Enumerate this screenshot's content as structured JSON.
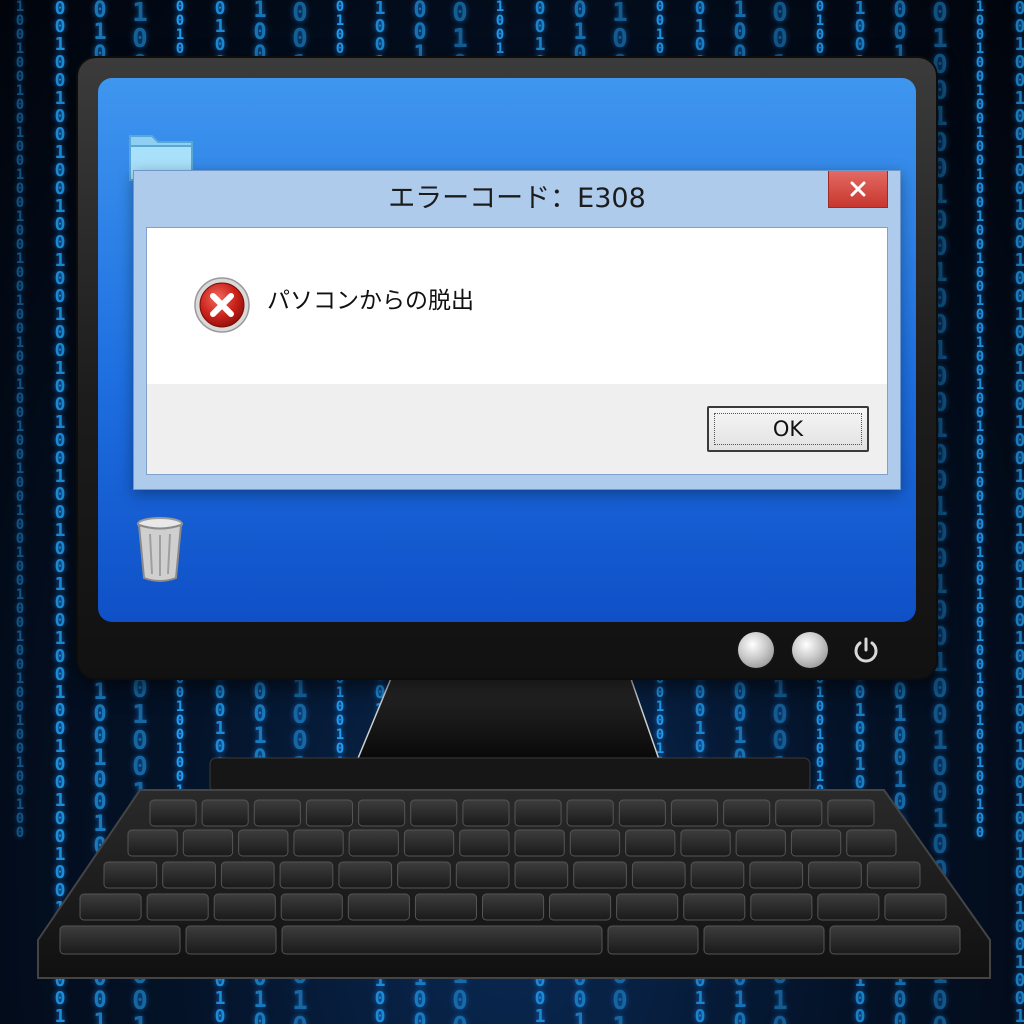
{
  "dialog": {
    "title": "エラーコード：E308",
    "message": "パソコンからの脱出",
    "ok_label": "OK"
  },
  "icons": {
    "folder": "folder-icon",
    "trash": "recycle-bin-icon",
    "error": "error-x-icon",
    "close": "close-icon",
    "power": "power-icon"
  },
  "colors": {
    "desktop_blue": "#1e6fe0",
    "dialog_frame": "#aecbec",
    "close_red": "#c7372f",
    "binary_glow": "#25a9ff"
  }
}
